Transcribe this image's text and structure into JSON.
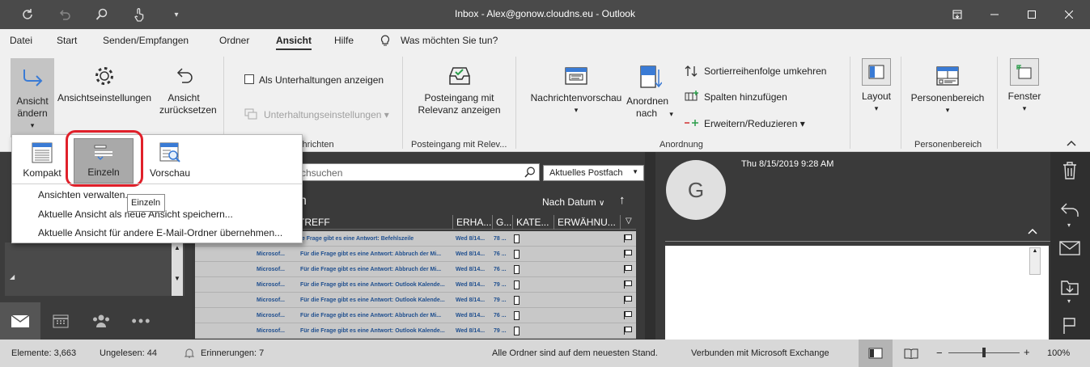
{
  "titlebar": {
    "title": "Inbox - Alex@gonow.cloudns.eu - Outlook",
    "quick_access": [
      "sync-icon",
      "undo-icon",
      "search-icon",
      "touch-mode-icon",
      "customize-icon"
    ],
    "window_controls": [
      "ribbon-display-icon",
      "minimize-icon",
      "maximize-icon",
      "close-icon"
    ]
  },
  "menubar": {
    "tabs": [
      "Datei",
      "Start",
      "Senden/Empfangen",
      "Ordner",
      "Ansicht",
      "Hilfe"
    ],
    "active_tab": "Ansicht",
    "tell_me": "Was möchten Sie tun?"
  },
  "ribbon": {
    "change_view": "Ansicht ändern",
    "view_settings": "Ansichtseinstellungen",
    "reset_view": "Ansicht zurücksetzen",
    "show_as_conversations": "Als Unterhaltungen anzeigen",
    "conversation_settings": "Unterhaltungseinstellungen",
    "messages_group": "chrichten",
    "focused_inbox": "Posteingang mit Relevanz anzeigen",
    "focused_group": "Posteingang mit Relev...",
    "message_preview": "Nachrichtenvorschau",
    "arrange_by": "Anordnen nach",
    "reverse_sort": "Sortierreihenfolge umkehren",
    "add_columns": "Spalten hinzufügen",
    "expand_collapse": "Erweitern/Reduzieren",
    "arrangement_group": "Anordnung",
    "layout": "Layout",
    "people_pane": "Personenbereich",
    "people_group": "Personenbereich",
    "window": "Fenster"
  },
  "dropdown": {
    "views": [
      "Kompakt",
      "Einzeln",
      "Vorschau"
    ],
    "selected": "Einzeln",
    "manage_views": "Ansichten verwalten...",
    "save_view": "Aktuelle Ansicht als neue Ansicht speichern...",
    "apply_view": "Aktuelle Ansicht für andere E-Mail-Ordner übernehmen...",
    "tooltip": "Einzeln"
  },
  "message_list": {
    "search_placeholder": "rchsuchen",
    "search_scope": "Aktuelles Postfach",
    "group_header_left": "n",
    "sort_label": "Nach Datum",
    "sort_arrow": "↑",
    "columns": [
      "TREFF",
      "ERHA...",
      "G...",
      "KATE...",
      "ERWÄHNU..."
    ],
    "rows": [
      {
        "from": "",
        "subject": "ie Frage gibt es eine Antwort: Befehlszeile",
        "date": "Wed 8/14...",
        "size": "78 ..."
      },
      {
        "from": "Microsof...",
        "subject": "Für die Frage gibt es eine Antwort: Abbruch der Mi...",
        "date": "Wed 8/14...",
        "size": "76 ..."
      },
      {
        "from": "Microsof...",
        "subject": "Für die Frage gibt es eine Antwort: Abbruch der Mi...",
        "date": "Wed 8/14...",
        "size": "76 ..."
      },
      {
        "from": "Microsof...",
        "subject": "Für die Frage gibt es eine Antwort: Outlook Kalende...",
        "date": "Wed 8/14...",
        "size": "79 ..."
      },
      {
        "from": "Microsof...",
        "subject": "Für die Frage gibt es eine Antwort: Outlook Kalende...",
        "date": "Wed 8/14...",
        "size": "79 ..."
      },
      {
        "from": "Microsof...",
        "subject": "Für die Frage gibt es eine Antwort: Abbruch der Mi...",
        "date": "Wed 8/14...",
        "size": "76 ..."
      },
      {
        "from": "Microsof...",
        "subject": "Für die Frage gibt es eine Antwort: Outlook Kalende...",
        "date": "Wed 8/14...",
        "size": "79 ..."
      }
    ]
  },
  "reading_pane": {
    "avatar_letter": "G",
    "timestamp": "Thu 8/15/2019 9:28 AM"
  },
  "statusbar": {
    "items": "Elemente: 3,663",
    "unread": "Ungelesen: 44",
    "reminders": "Erinnerungen: 7",
    "sync_status": "Alle Ordner sind auf dem neuesten Stand.",
    "connection": "Verbunden mit Microsoft Exchange",
    "zoom": "100%"
  },
  "colors": {
    "accent_red": "#e0202a",
    "titlebar": "#4a4a4a",
    "link_blue": "#1f4f8f"
  }
}
